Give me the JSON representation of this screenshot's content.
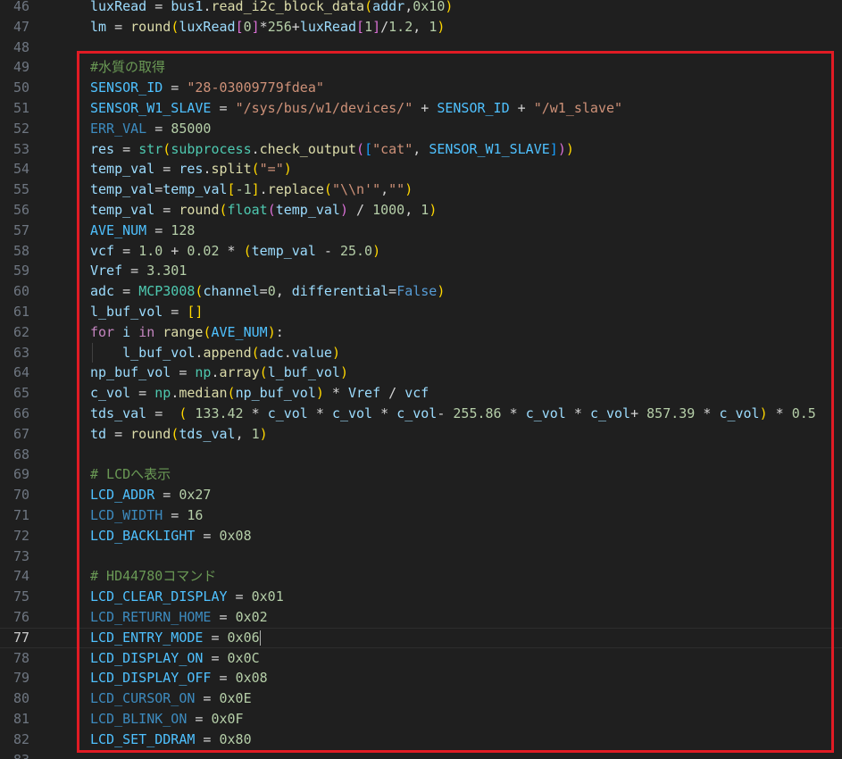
{
  "editor": {
    "active_line": "77",
    "first_line": 46,
    "lines": [
      {
        "num": "46",
        "tokens": [
          [
            "v",
            "luxRead"
          ],
          [
            "o",
            " = "
          ],
          [
            "v",
            "bus1"
          ],
          [
            "o",
            "."
          ],
          [
            "f",
            "read_i2c_block_data"
          ],
          [
            "b1",
            "("
          ],
          [
            "v",
            "addr"
          ],
          [
            "o",
            ","
          ],
          [
            "n",
            "0x10"
          ],
          [
            "b1",
            ")"
          ]
        ]
      },
      {
        "num": "47",
        "tokens": [
          [
            "v",
            "lm"
          ],
          [
            "o",
            " = "
          ],
          [
            "f",
            "round"
          ],
          [
            "b1",
            "("
          ],
          [
            "v",
            "luxRead"
          ],
          [
            "b2",
            "["
          ],
          [
            "n",
            "0"
          ],
          [
            "b2",
            "]"
          ],
          [
            "o",
            "*"
          ],
          [
            "n",
            "256"
          ],
          [
            "o",
            "+"
          ],
          [
            "v",
            "luxRead"
          ],
          [
            "b2",
            "["
          ],
          [
            "n",
            "1"
          ],
          [
            "b2",
            "]"
          ],
          [
            "o",
            "/"
          ],
          [
            "n",
            "1.2"
          ],
          [
            "o",
            ", "
          ],
          [
            "n",
            "1"
          ],
          [
            "b1",
            ")"
          ]
        ]
      },
      {
        "num": "48",
        "tokens": []
      },
      {
        "num": "49",
        "tokens": [
          [
            "cm",
            "#水質の取得"
          ]
        ]
      },
      {
        "num": "50",
        "tokens": [
          [
            "c",
            "SENSOR_ID"
          ],
          [
            "o",
            " = "
          ],
          [
            "s",
            "\"28-03009779fdea\""
          ]
        ]
      },
      {
        "num": "51",
        "tokens": [
          [
            "c",
            "SENSOR_W1_SLAVE"
          ],
          [
            "o",
            " = "
          ],
          [
            "s",
            "\"/sys/bus/w1/devices/\""
          ],
          [
            "o",
            " + "
          ],
          [
            "c",
            "SENSOR_ID"
          ],
          [
            "o",
            " + "
          ],
          [
            "s",
            "\"/w1_slave\""
          ]
        ]
      },
      {
        "num": "52",
        "tokens": [
          [
            "cd",
            "ERR_VAL"
          ],
          [
            "o",
            " = "
          ],
          [
            "n",
            "85000"
          ]
        ]
      },
      {
        "num": "53",
        "tokens": [
          [
            "v",
            "res"
          ],
          [
            "o",
            " = "
          ],
          [
            "ty",
            "str"
          ],
          [
            "b1",
            "("
          ],
          [
            "ty",
            "subprocess"
          ],
          [
            "o",
            "."
          ],
          [
            "f",
            "check_output"
          ],
          [
            "b2",
            "("
          ],
          [
            "b3",
            "["
          ],
          [
            "s",
            "\"cat\""
          ],
          [
            "o",
            ", "
          ],
          [
            "c",
            "SENSOR_W1_SLAVE"
          ],
          [
            "b3",
            "]"
          ],
          [
            "b2",
            ")"
          ],
          [
            "b1",
            ")"
          ]
        ]
      },
      {
        "num": "54",
        "tokens": [
          [
            "v",
            "temp_val"
          ],
          [
            "o",
            " = "
          ],
          [
            "v",
            "res"
          ],
          [
            "o",
            "."
          ],
          [
            "f",
            "split"
          ],
          [
            "b1",
            "("
          ],
          [
            "s",
            "\"=\""
          ],
          [
            "b1",
            ")"
          ]
        ]
      },
      {
        "num": "55",
        "tokens": [
          [
            "v",
            "temp_val"
          ],
          [
            "o",
            "="
          ],
          [
            "v",
            "temp_val"
          ],
          [
            "b1",
            "["
          ],
          [
            "n",
            "-1"
          ],
          [
            "b1",
            "]"
          ],
          [
            "o",
            "."
          ],
          [
            "f",
            "replace"
          ],
          [
            "b1",
            "("
          ],
          [
            "s",
            "\"\\\\n'\""
          ],
          [
            "o",
            ","
          ],
          [
            "s",
            "\"\""
          ],
          [
            "b1",
            ")"
          ]
        ]
      },
      {
        "num": "56",
        "tokens": [
          [
            "v",
            "temp_val"
          ],
          [
            "o",
            " = "
          ],
          [
            "f",
            "round"
          ],
          [
            "b1",
            "("
          ],
          [
            "ty",
            "float"
          ],
          [
            "b2",
            "("
          ],
          [
            "v",
            "temp_val"
          ],
          [
            "b2",
            ")"
          ],
          [
            "o",
            " / "
          ],
          [
            "n",
            "1000"
          ],
          [
            "o",
            ", "
          ],
          [
            "n",
            "1"
          ],
          [
            "b1",
            ")"
          ]
        ]
      },
      {
        "num": "57",
        "tokens": [
          [
            "c",
            "AVE_NUM"
          ],
          [
            "o",
            " = "
          ],
          [
            "n",
            "128"
          ]
        ]
      },
      {
        "num": "58",
        "tokens": [
          [
            "v",
            "vcf"
          ],
          [
            "o",
            " = "
          ],
          [
            "n",
            "1.0"
          ],
          [
            "o",
            " + "
          ],
          [
            "n",
            "0.02"
          ],
          [
            "o",
            " * "
          ],
          [
            "b1",
            "("
          ],
          [
            "v",
            "temp_val"
          ],
          [
            "o",
            " - "
          ],
          [
            "n",
            "25.0"
          ],
          [
            "b1",
            ")"
          ]
        ]
      },
      {
        "num": "59",
        "tokens": [
          [
            "v",
            "Vref"
          ],
          [
            "o",
            " = "
          ],
          [
            "n",
            "3.301"
          ]
        ]
      },
      {
        "num": "60",
        "tokens": [
          [
            "v",
            "adc"
          ],
          [
            "o",
            " = "
          ],
          [
            "ty",
            "MCP3008"
          ],
          [
            "b1",
            "("
          ],
          [
            "v",
            "channel"
          ],
          [
            "o",
            "="
          ],
          [
            "n",
            "0"
          ],
          [
            "o",
            ", "
          ],
          [
            "v",
            "differential"
          ],
          [
            "o",
            "="
          ],
          [
            "bl",
            "False"
          ],
          [
            "b1",
            ")"
          ]
        ]
      },
      {
        "num": "61",
        "tokens": [
          [
            "v",
            "l_buf_vol"
          ],
          [
            "o",
            " = "
          ],
          [
            "b1",
            "[]"
          ]
        ]
      },
      {
        "num": "62",
        "tokens": [
          [
            "k",
            "for"
          ],
          [
            "o",
            " "
          ],
          [
            "v",
            "i"
          ],
          [
            "o",
            " "
          ],
          [
            "k",
            "in"
          ],
          [
            "o",
            " "
          ],
          [
            "f",
            "range"
          ],
          [
            "b1",
            "("
          ],
          [
            "c",
            "AVE_NUM"
          ],
          [
            "b1",
            ")"
          ],
          [
            "o",
            ":"
          ]
        ]
      },
      {
        "num": "63",
        "guide": true,
        "tokens": [
          [
            "o",
            "    "
          ],
          [
            "v",
            "l_buf_vol"
          ],
          [
            "o",
            "."
          ],
          [
            "f",
            "append"
          ],
          [
            "b1",
            "("
          ],
          [
            "v",
            "adc"
          ],
          [
            "o",
            "."
          ],
          [
            "v",
            "value"
          ],
          [
            "b1",
            ")"
          ]
        ]
      },
      {
        "num": "64",
        "tokens": [
          [
            "v",
            "np_buf_vol"
          ],
          [
            "o",
            " = "
          ],
          [
            "ty",
            "np"
          ],
          [
            "o",
            "."
          ],
          [
            "f",
            "array"
          ],
          [
            "b1",
            "("
          ],
          [
            "v",
            "l_buf_vol"
          ],
          [
            "b1",
            ")"
          ]
        ]
      },
      {
        "num": "65",
        "tokens": [
          [
            "v",
            "c_vol"
          ],
          [
            "o",
            " = "
          ],
          [
            "ty",
            "np"
          ],
          [
            "o",
            "."
          ],
          [
            "f",
            "median"
          ],
          [
            "b1",
            "("
          ],
          [
            "v",
            "np_buf_vol"
          ],
          [
            "b1",
            ")"
          ],
          [
            "o",
            " * "
          ],
          [
            "v",
            "Vref"
          ],
          [
            "o",
            " / "
          ],
          [
            "v",
            "vcf"
          ]
        ]
      },
      {
        "num": "66",
        "tokens": [
          [
            "v",
            "tds_val"
          ],
          [
            "o",
            " =  "
          ],
          [
            "b1",
            "("
          ],
          [
            "o",
            " "
          ],
          [
            "n",
            "133.42"
          ],
          [
            "o",
            " * "
          ],
          [
            "v",
            "c_vol"
          ],
          [
            "o",
            " * "
          ],
          [
            "v",
            "c_vol"
          ],
          [
            "o",
            " * "
          ],
          [
            "v",
            "c_vol"
          ],
          [
            "o",
            "- "
          ],
          [
            "n",
            "255.86"
          ],
          [
            "o",
            " * "
          ],
          [
            "v",
            "c_vol"
          ],
          [
            "o",
            " * "
          ],
          [
            "v",
            "c_vol"
          ],
          [
            "o",
            "+ "
          ],
          [
            "n",
            "857.39"
          ],
          [
            "o",
            " * "
          ],
          [
            "v",
            "c_vol"
          ],
          [
            "b1",
            ")"
          ],
          [
            "o",
            " * "
          ],
          [
            "n",
            "0.5"
          ]
        ]
      },
      {
        "num": "67",
        "tokens": [
          [
            "v",
            "td"
          ],
          [
            "o",
            " = "
          ],
          [
            "f",
            "round"
          ],
          [
            "b1",
            "("
          ],
          [
            "v",
            "tds_val"
          ],
          [
            "o",
            ", "
          ],
          [
            "n",
            "1"
          ],
          [
            "b1",
            ")"
          ]
        ]
      },
      {
        "num": "68",
        "tokens": []
      },
      {
        "num": "69",
        "tokens": [
          [
            "cm",
            "# LCDへ表示"
          ]
        ]
      },
      {
        "num": "70",
        "tokens": [
          [
            "c",
            "LCD_ADDR"
          ],
          [
            "o",
            " = "
          ],
          [
            "n",
            "0x27"
          ]
        ]
      },
      {
        "num": "71",
        "tokens": [
          [
            "cd",
            "LCD_WIDTH"
          ],
          [
            "o",
            " = "
          ],
          [
            "n",
            "16"
          ]
        ]
      },
      {
        "num": "72",
        "tokens": [
          [
            "c",
            "LCD_BACKLIGHT"
          ],
          [
            "o",
            " = "
          ],
          [
            "n",
            "0x08"
          ]
        ]
      },
      {
        "num": "73",
        "tokens": []
      },
      {
        "num": "74",
        "tokens": [
          [
            "cm",
            "# HD44780コマンド"
          ]
        ]
      },
      {
        "num": "75",
        "tokens": [
          [
            "c",
            "LCD_CLEAR_DISPLAY"
          ],
          [
            "o",
            " = "
          ],
          [
            "n",
            "0x01"
          ]
        ]
      },
      {
        "num": "76",
        "tokens": [
          [
            "cd",
            "LCD_RETURN_HOME"
          ],
          [
            "o",
            " = "
          ],
          [
            "n",
            "0x02"
          ]
        ]
      },
      {
        "num": "77",
        "cursor": true,
        "tokens": [
          [
            "c",
            "LCD_ENTRY_MODE"
          ],
          [
            "o",
            " = "
          ],
          [
            "n",
            "0x06"
          ]
        ]
      },
      {
        "num": "78",
        "tokens": [
          [
            "c",
            "LCD_DISPLAY_ON"
          ],
          [
            "o",
            " = "
          ],
          [
            "n",
            "0x0C"
          ]
        ]
      },
      {
        "num": "79",
        "tokens": [
          [
            "c",
            "LCD_DISPLAY_OFF"
          ],
          [
            "o",
            " = "
          ],
          [
            "n",
            "0x08"
          ]
        ]
      },
      {
        "num": "80",
        "tokens": [
          [
            "cd",
            "LCD_CURSOR_ON"
          ],
          [
            "o",
            " = "
          ],
          [
            "n",
            "0x0E"
          ]
        ]
      },
      {
        "num": "81",
        "tokens": [
          [
            "cd",
            "LCD_BLINK_ON"
          ],
          [
            "o",
            " = "
          ],
          [
            "n",
            "0x0F"
          ]
        ]
      },
      {
        "num": "82",
        "tokens": [
          [
            "c",
            "LCD_SET_DDRAM"
          ],
          [
            "o",
            " = "
          ],
          [
            "n",
            "0x80"
          ]
        ]
      },
      {
        "num": "83",
        "tokens": []
      }
    ]
  },
  "colors": {
    "background": "#1f1f1f",
    "highlight_box": "#e01b24"
  }
}
